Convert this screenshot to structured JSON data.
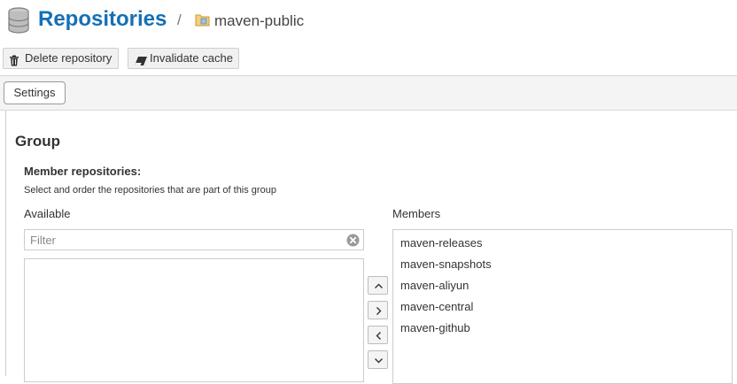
{
  "header": {
    "title": "Repositories",
    "separator": "/",
    "repo_name": "maven-public",
    "icons": [
      "database-icon",
      "folder-repo-icon"
    ]
  },
  "toolbar": {
    "delete_label": "Delete repository",
    "invalidate_label": "Invalidate cache",
    "icons": [
      "trash-icon",
      "eraser-icon"
    ]
  },
  "tabs": [
    {
      "label": "Settings"
    }
  ],
  "group": {
    "heading": "Group",
    "member_repos_label": "Member repositories:",
    "help_text": "Select and order the repositories that are part of this group",
    "available_label": "Available",
    "members_label": "Members",
    "filter_placeholder": "Filter",
    "members": [
      "maven-releases",
      "maven-snapshots",
      "maven-aliyun",
      "maven-central",
      "maven-github"
    ],
    "move_buttons": [
      "move-up-icon",
      "move-right-icon",
      "move-left-icon",
      "move-down-icon"
    ]
  },
  "colors": {
    "accent": "#1570b5"
  }
}
